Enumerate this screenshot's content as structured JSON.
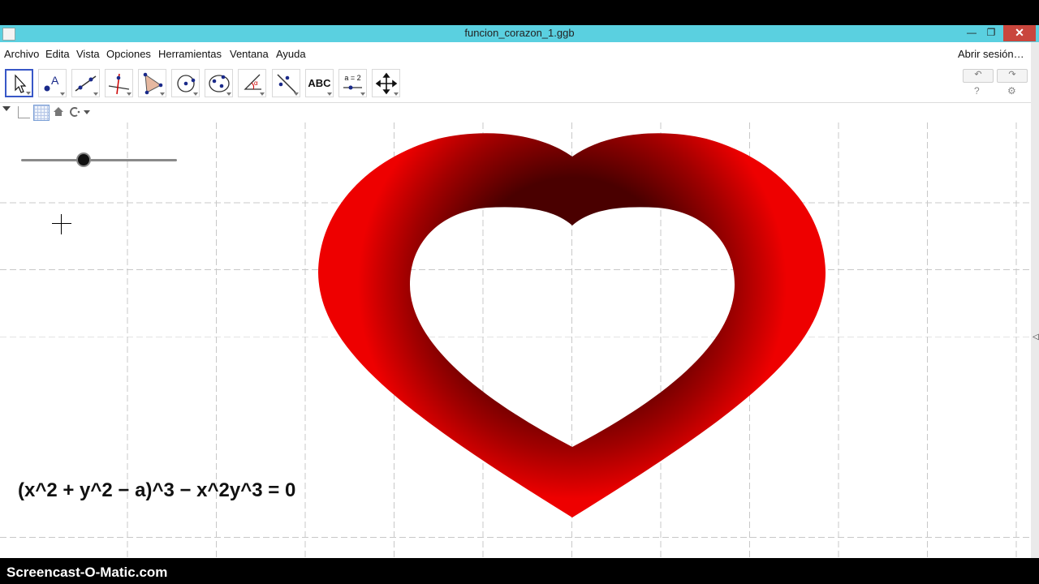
{
  "window": {
    "title": "funcion_corazon_1.ggb",
    "minimize": "—",
    "restore": "❐",
    "close": "✕"
  },
  "menu": [
    "Archivo",
    "Edita",
    "Vista",
    "Opciones",
    "Herramientas",
    "Ventana",
    "Ayuda"
  ],
  "login": "Abrir sesión…",
  "toolbar": {
    "tools": [
      "move-tool",
      "point-tool",
      "line-tool",
      "perpendicular-tool",
      "polygon-tool",
      "circle-tool",
      "conic-tool",
      "angle-tool",
      "reflect-tool",
      "text-tool",
      "slider-tool",
      "move-view-tool"
    ],
    "text_tool_label": "ABC",
    "slider_tool_label": "a = 2",
    "undo": "↶",
    "redo": "↷",
    "help": "?",
    "settings": "⚙"
  },
  "graphics": {
    "equation": "(x^2 + y^2 − a)^3 − x^2y^3 = 0",
    "slider_value": 0.4,
    "heart_colors": {
      "outer": "#ee0000",
      "inner": "#4a0000"
    }
  },
  "watermark": "Screencast-O-Matic.com"
}
